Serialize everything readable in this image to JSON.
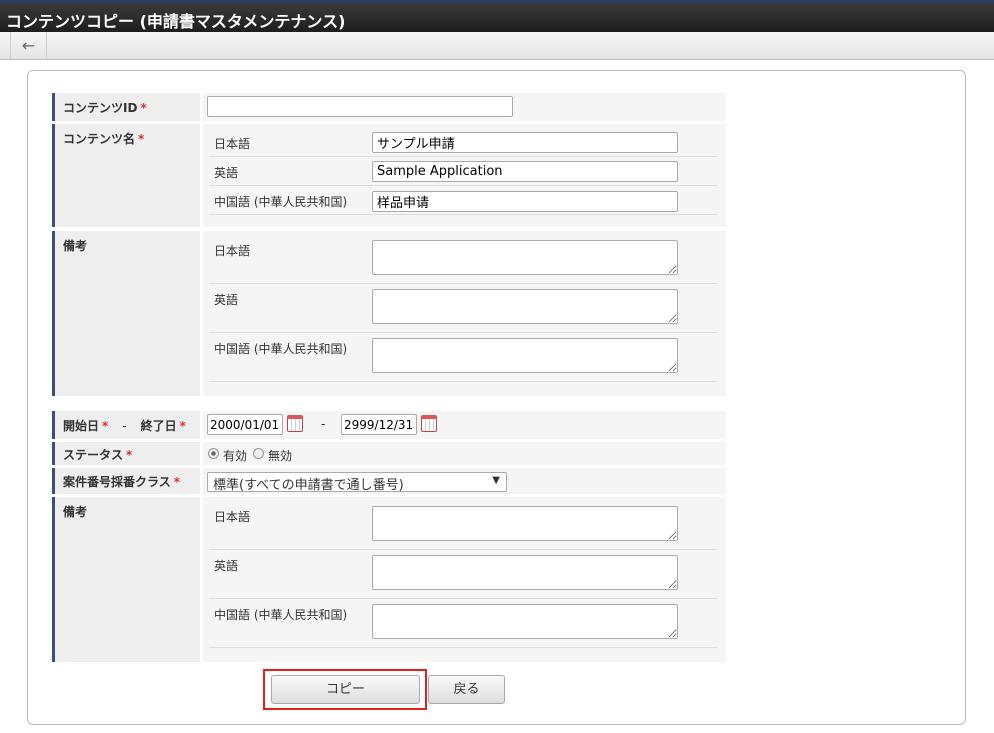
{
  "title": "コンテンツコピー (申請書マスタメンテナンス)",
  "toolbar": {
    "back_icon": "←"
  },
  "form": {
    "required_mark": "*",
    "content_id": {
      "label": "コンテンツID",
      "value": ""
    },
    "content_name": {
      "label": "コンテンツ名",
      "langs": [
        {
          "label": "日本語",
          "value": "サンプル申請"
        },
        {
          "label": "英語",
          "value": "Sample Application"
        },
        {
          "label": "中国語 (中華人民共和国)",
          "value": "样品申请"
        }
      ]
    },
    "remarks1": {
      "label": "備考",
      "langs": [
        {
          "label": "日本語"
        },
        {
          "label": "英語"
        },
        {
          "label": "中国語 (中華人民共和国)"
        }
      ]
    },
    "period": {
      "start_label": "開始日",
      "sep": "-",
      "end_label": "終了日",
      "start": "2000/01/01",
      "end": "2999/12/31"
    },
    "status": {
      "label": "ステータス",
      "options": [
        "有効",
        "無効"
      ],
      "selected": "有効"
    },
    "numbering": {
      "label": "案件番号採番クラス",
      "value": "標準(すべての申請書で通し番号)",
      "arrow": "▼"
    },
    "remarks2": {
      "label": "備考",
      "langs": [
        {
          "label": "日本語"
        },
        {
          "label": "英語"
        },
        {
          "label": "中国語 (中華人民共和国)"
        }
      ]
    }
  },
  "buttons": {
    "copy": "コピー",
    "back": "戻る"
  },
  "colors": {
    "highlight": "#e02020",
    "label_border": "#3a4f7a"
  }
}
